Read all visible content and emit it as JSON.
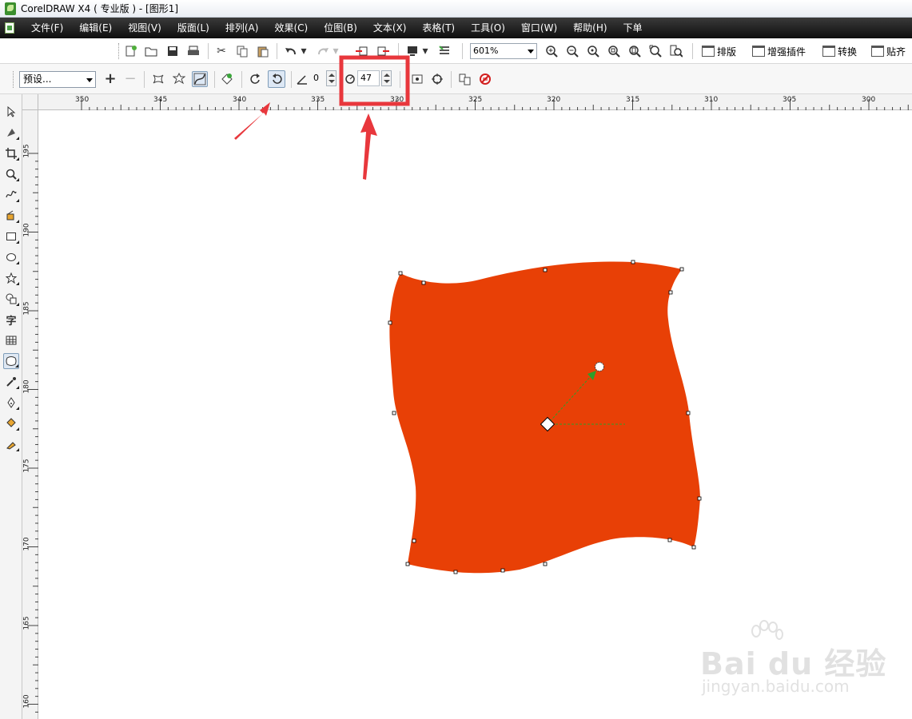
{
  "window": {
    "title": "CorelDRAW X4 ( 专业版 ) - [图形1]"
  },
  "menu": {
    "items": [
      "文件(F)",
      "编辑(E)",
      "视图(V)",
      "版面(L)",
      "排列(A)",
      "效果(C)",
      "位图(B)",
      "文本(X)",
      "表格(T)",
      "工具(O)",
      "窗口(W)",
      "帮助(H)",
      "下单"
    ]
  },
  "standard_toolbar": {
    "zoom_level": "601%",
    "plugins": [
      "排版",
      "增强插件",
      "转换",
      "贴齐"
    ]
  },
  "property_bar": {
    "preset_label": "预设...",
    "distortion_angle": "0",
    "distortion_amount": "47",
    "active_mode": "counterclockwise-twister"
  },
  "rulers": {
    "horizontal_labels": [
      "350",
      "345",
      "340",
      "335",
      "330",
      "325",
      "320",
      "315",
      "310",
      "305",
      "300"
    ],
    "vertical_labels": [
      "195",
      "190",
      "185",
      "180",
      "175",
      "170",
      "165",
      "160"
    ]
  },
  "colors": {
    "shape_fill": "#e84006",
    "annotation_red": "#e8373c",
    "vector_green": "#2e9e2a"
  },
  "watermark": {
    "brand": "Bai du 经验",
    "url": "jingyan.baidu.com"
  }
}
